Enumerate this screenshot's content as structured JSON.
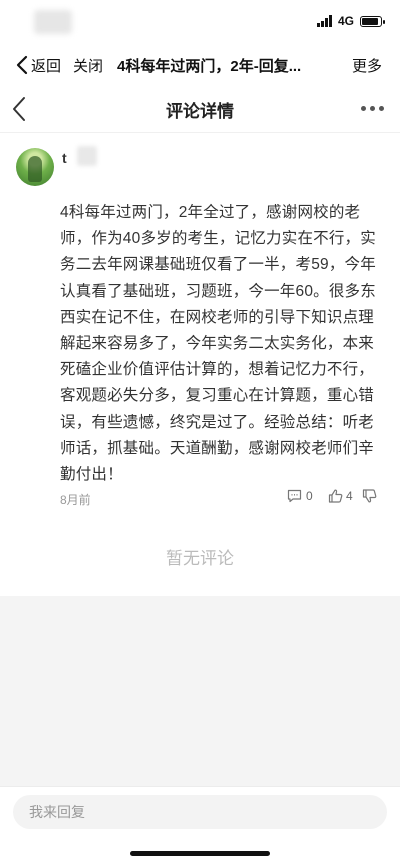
{
  "status": {
    "network": "4G"
  },
  "topnav": {
    "back_label": "返回",
    "close_label": "关闭",
    "title": "4科每年过两门，2年-回复...",
    "more_label": "更多"
  },
  "header": {
    "title": "评论详情"
  },
  "comment": {
    "username": "t",
    "text": "4科每年过两门，2年全过了，感谢网校的老师，作为40多岁的考生，记忆力实在不行，实务二去年网课基础班仅看了一半，考59，今年认真看了基础班，习题班，今一年60。很多东西实在记不住，在网校老师的引导下知识点理解起来容易多了，今年实务二太实务化，本来死磕企业价值评估计算的，想着记忆力不行，客观题必失分多，复习重心在计算题，重心错误，有些遗憾，终究是过了。经验总结：听老师话，抓基础。天道酬勤，感谢网校老师们辛勤付出！",
    "time": "8月前",
    "reply_count": "0",
    "like_count": "4"
  },
  "empty_state": "暂无评论",
  "reply_bar": {
    "placeholder": "我来回复"
  }
}
